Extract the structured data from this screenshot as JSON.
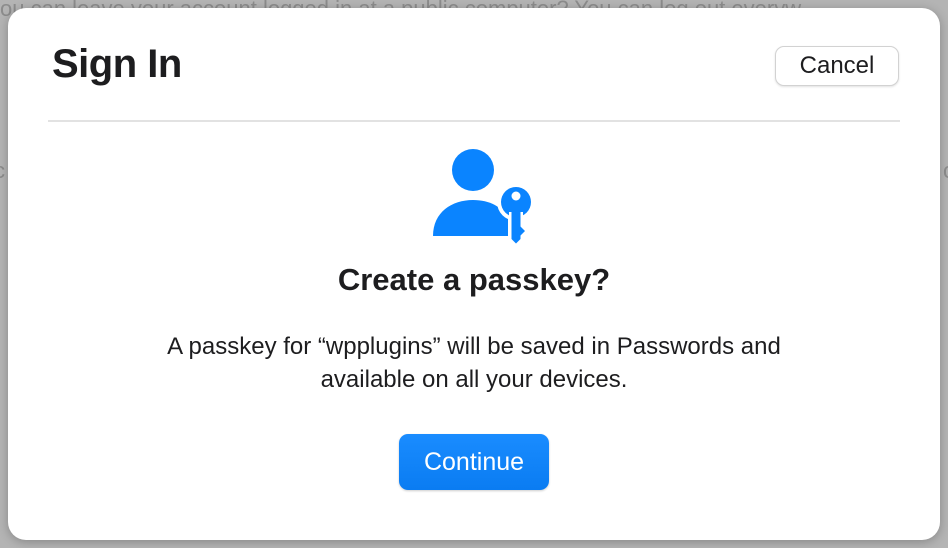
{
  "background": {
    "partial_text_line": "ou can leave your account logged in at a public computer? You can log out everyw",
    "left_fragment": "c",
    "right_fragment": "c"
  },
  "dialog": {
    "title": "Sign In",
    "cancel_label": "Cancel",
    "heading": "Create a passkey?",
    "description_line1": "A passkey for “wpplugins” will be saved in Passwords and",
    "description_line2": "available on all your devices.",
    "continue_label": "Continue",
    "icon": "person-key-icon"
  },
  "colors": {
    "accent": "#0a7cf2",
    "icon": "#0a84ff"
  }
}
